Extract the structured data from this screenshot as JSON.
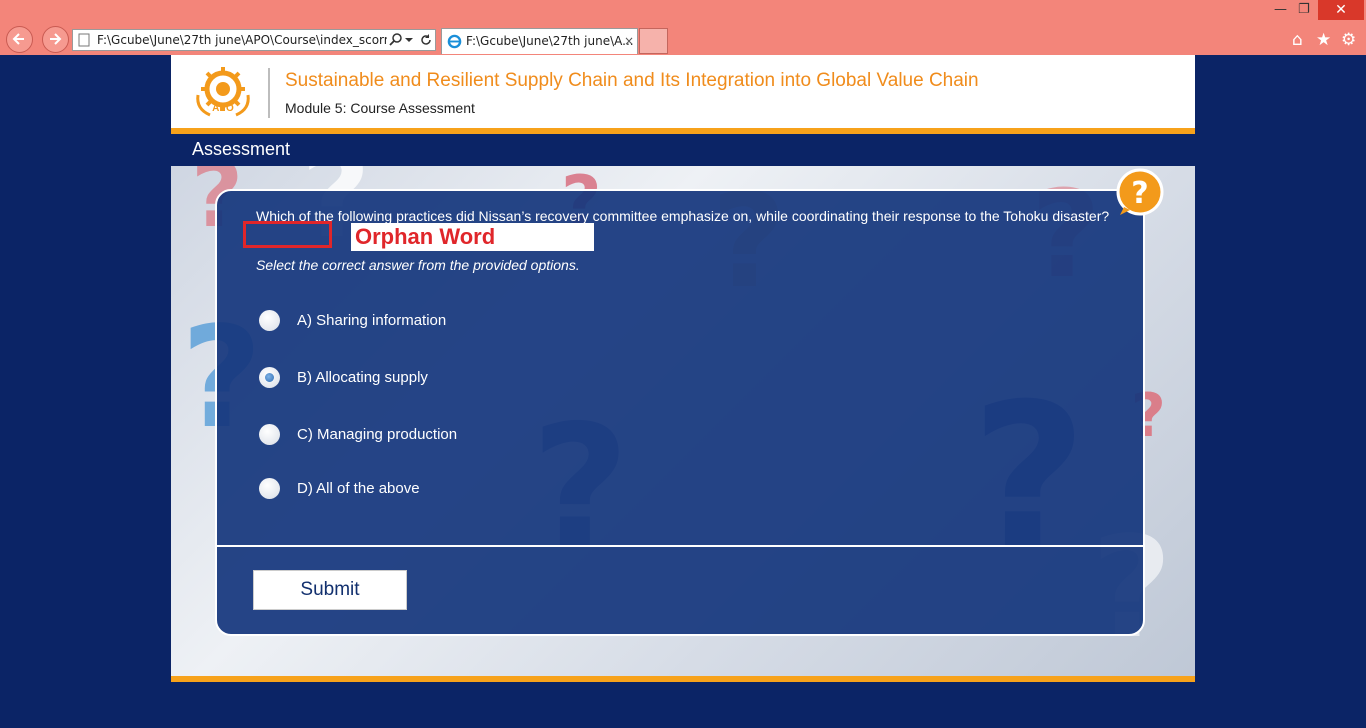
{
  "browser": {
    "address_url": "F:\\Gcube\\June\\27th june\\APO\\Course\\index_scorm.ht",
    "tab_title": "F:\\Gcube\\June\\27th june\\A...",
    "close_tab_glyph": "×"
  },
  "header": {
    "logo_text": "APO",
    "course_title": "Sustainable and Resilient Supply Chain and Its Integration into Global Value Chain",
    "module_title": "Module 5: Course Assessment"
  },
  "section": {
    "title": "Assessment"
  },
  "question": {
    "text": "Which of the following practices did Nissan’s recovery committee emphasize on, while coordinating their response to the Tohoku disaster?",
    "instruction": "Select the correct answer from the provided options."
  },
  "annotation": {
    "label": "Orphan Word",
    "color": "#e0262a"
  },
  "options": [
    {
      "label": "A)  Sharing information",
      "selected": false
    },
    {
      "label": "B)  Allocating supply",
      "selected": true
    },
    {
      "label": "C)  Managing production",
      "selected": false
    },
    {
      "label": "D)  All of the above",
      "selected": false
    }
  ],
  "submit_label": "Submit",
  "colors": {
    "accent_orange": "#f7a21b",
    "navy": "#0b2466",
    "chrome": "#f3857a"
  }
}
